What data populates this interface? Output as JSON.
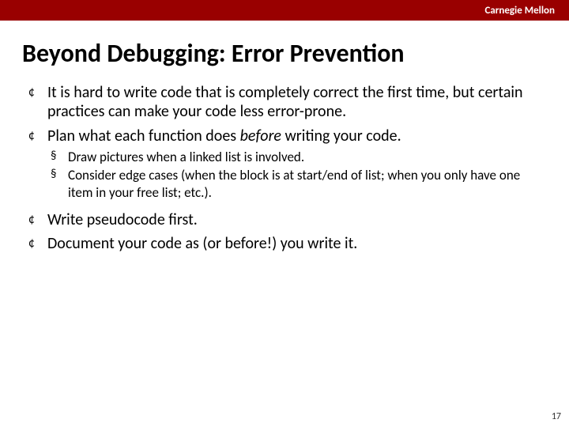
{
  "header": {
    "org": "Carnegie Mellon"
  },
  "title": "Beyond Debugging: Error Prevention",
  "bullets": {
    "b1": "It is hard to write code that is completely correct the first time, but certain practices can make your code less error-prone.",
    "b2_pre": "Plan what each function does ",
    "b2_em": "before",
    "b2_post": " writing your code.",
    "b2_sub1": "Draw pictures when a linked list is involved.",
    "b2_sub2": "Consider edge cases (when the block is at start/end of list; when you only have one item in your free list; etc.).",
    "b3": "Write pseudocode first.",
    "b4": "Document your code as (or before!) you write it."
  },
  "page_number": "17"
}
